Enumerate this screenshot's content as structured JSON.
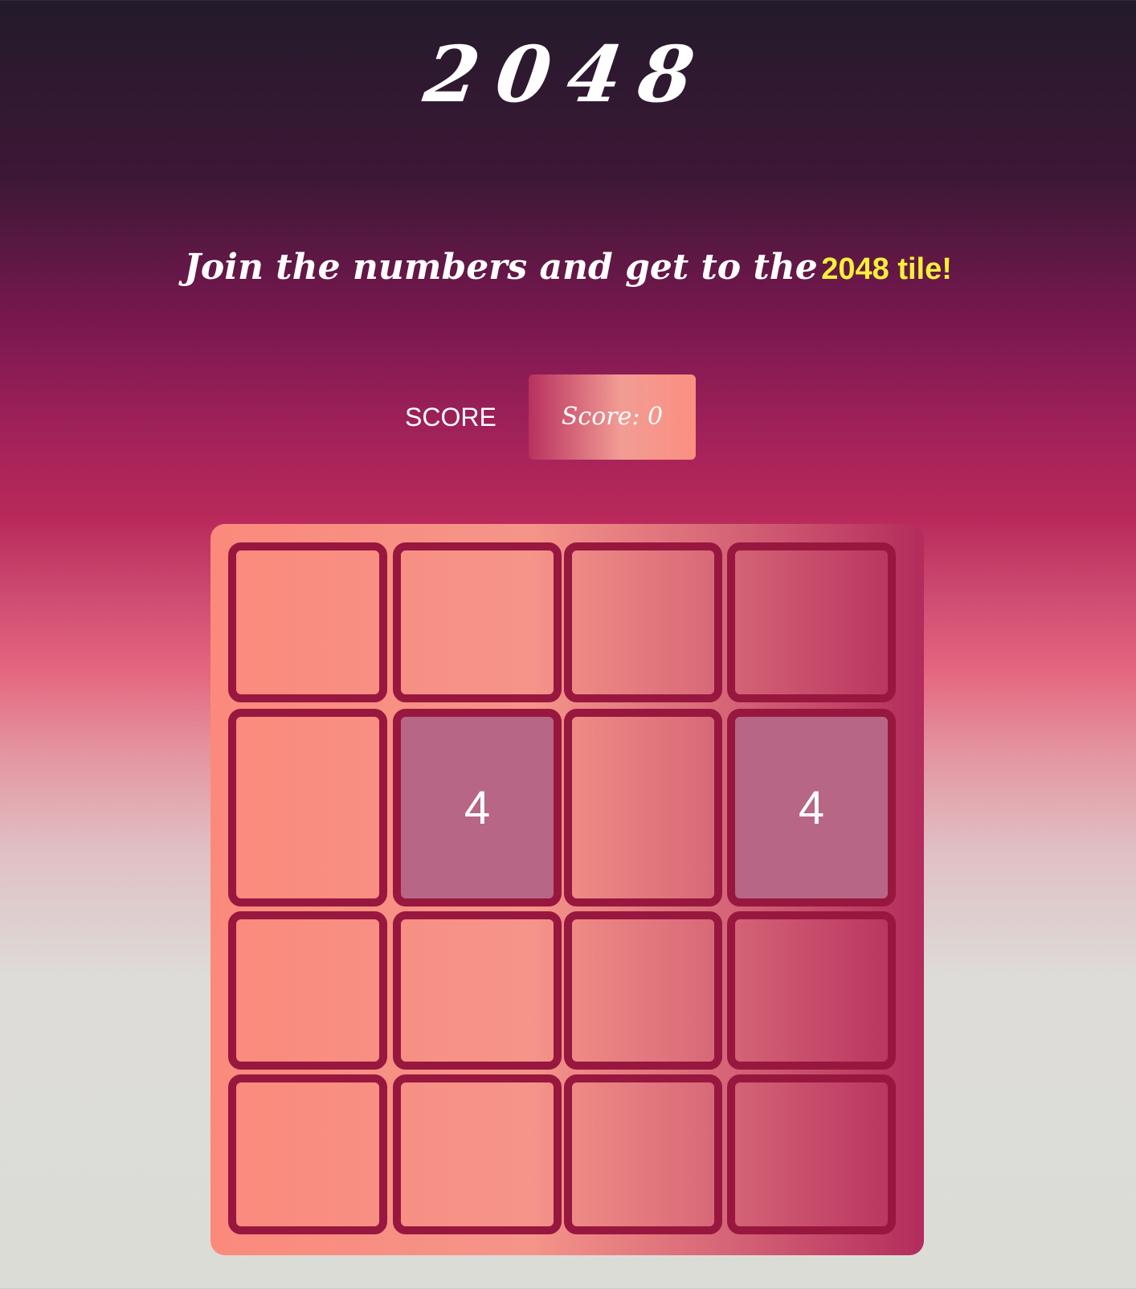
{
  "header": {
    "title": "2048",
    "tagline_script": "Join the numbers and get to the",
    "tagline_highlight": "2048 tile!"
  },
  "score": {
    "label": "SCORE",
    "display": "Score: 0"
  },
  "board": {
    "rows": 4,
    "cols": 4,
    "cells": [
      [
        "",
        "",
        "",
        ""
      ],
      [
        "",
        "4",
        "",
        "4"
      ],
      [
        "",
        "",
        "",
        ""
      ],
      [
        "",
        "",
        "",
        ""
      ]
    ]
  },
  "colors": {
    "tile_4": "#b76686",
    "cell_border": "#98173f",
    "highlight": "#f7f03a"
  }
}
